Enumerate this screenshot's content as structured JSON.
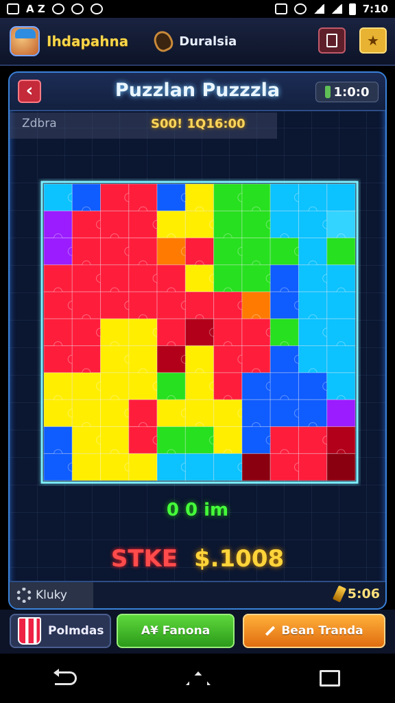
{
  "status_bar": {
    "left_text": "A Z",
    "time": "7:10"
  },
  "app_header": {
    "brand": "Ihdapahna",
    "region": "Duralsia",
    "stop_icon": "stop-square-icon",
    "star_icon": "★"
  },
  "puzzle": {
    "title": "Puzzlan Puzzzla",
    "back_icon": "‹",
    "timer": "1:0:0",
    "sub_label": "Zdbra",
    "score_text": "S00! 1Q16:00",
    "moves_text": "0 0 im",
    "stake_label": "STKE",
    "stake_amount": "$.1008",
    "settings_label": "Kluky",
    "gold_value": "5:06"
  },
  "board": {
    "cols": 11,
    "rows": 11,
    "palette": {
      "R": "#ff1d3c",
      "D": "#b3001a",
      "Y": "#ffee00",
      "G": "#27e01f",
      "B": "#0f5cff",
      "C": "#0cc2ff",
      "O": "#ff7a00",
      "P": "#9b1cff",
      "K": "#8a0010",
      "L": "#33d4ff"
    },
    "grid": [
      "CBRRBYGGCCC",
      "PRRRYYGGCCL",
      "PRRRORGGGCG",
      "RRRRRYGGBCC",
      "RRRRRRROBCC",
      "RRYYRDRRGCC",
      "RRYYDYRRBCC",
      "YYYYGYRBBBC",
      "YYYRYYYBBBP",
      "BYYRGGYBRRD",
      "BYYYCCCKRRK"
    ]
  },
  "actions": {
    "palette_label": "Polmdas",
    "green_label": "A¥ Fanona",
    "orange_label": "Bean Tranda"
  },
  "colors": {
    "accent_blue": "#3a82d9",
    "stake_red": "#ff4b4b",
    "stake_gold": "#ffd43a",
    "moves_green": "#45ff3a"
  }
}
